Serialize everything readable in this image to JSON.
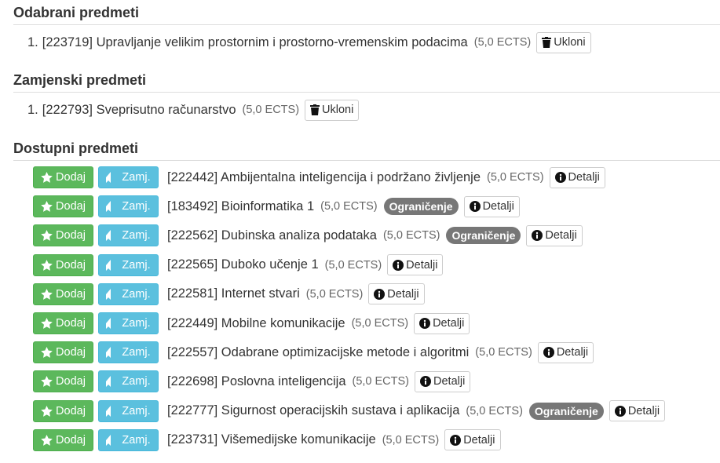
{
  "selected": {
    "title": "Odabrani predmeti",
    "items": [
      {
        "num": "1.",
        "name": "[223719] Upravljanje velikim prostornim i prostorno-vremenskim podacima",
        "ects": "(5,0 ECTS)",
        "remove_label": "Ukloni"
      }
    ]
  },
  "replacement": {
    "title": "Zamjenski predmeti",
    "items": [
      {
        "num": "1.",
        "name": "[222793] Sveprisutno računarstvo",
        "ects": "(5,0 ECTS)",
        "remove_label": "Ukloni"
      }
    ]
  },
  "available": {
    "title": "Dostupni predmeti",
    "add_label": "Dodaj",
    "swap_label": "Zamj.",
    "details_label": "Detalji",
    "items": [
      {
        "name": "[222442] Ambijentalna inteligencija i podržano življenje",
        "ects": "(5,0 ECTS)",
        "restriction": ""
      },
      {
        "name": "[183492] Bioinformatika 1",
        "ects": "(5,0 ECTS)",
        "restriction": "Ograničenje"
      },
      {
        "name": "[222562] Dubinska analiza podataka",
        "ects": "(5,0 ECTS)",
        "restriction": "Ograničenje"
      },
      {
        "name": "[222565] Duboko učenje 1",
        "ects": "(5,0 ECTS)",
        "restriction": ""
      },
      {
        "name": "[222581] Internet stvari",
        "ects": "(5,0 ECTS)",
        "restriction": ""
      },
      {
        "name": "[222449] Mobilne komunikacije",
        "ects": "(5,0 ECTS)",
        "restriction": ""
      },
      {
        "name": "[222557] Odabrane optimizacijske metode i algoritmi",
        "ects": "(5,0 ECTS)",
        "restriction": ""
      },
      {
        "name": "[222698] Poslovna inteligencija",
        "ects": "(5,0 ECTS)",
        "restriction": ""
      },
      {
        "name": "[222777] Sigurnost operacijskih sustava i aplikacija",
        "ects": "(5,0 ECTS)",
        "restriction": "Ograničenje"
      },
      {
        "name": "[223731] Višemedijske komunikacije",
        "ects": "(5,0 ECTS)",
        "restriction": ""
      }
    ]
  },
  "icons": {
    "remove": "trash-icon",
    "add": "star-icon",
    "swap": "bookmark-icon",
    "details": "info-icon"
  },
  "colors": {
    "add_button": "#5cb85c",
    "swap_button": "#5bc0de",
    "restriction_badge": "#777777"
  }
}
